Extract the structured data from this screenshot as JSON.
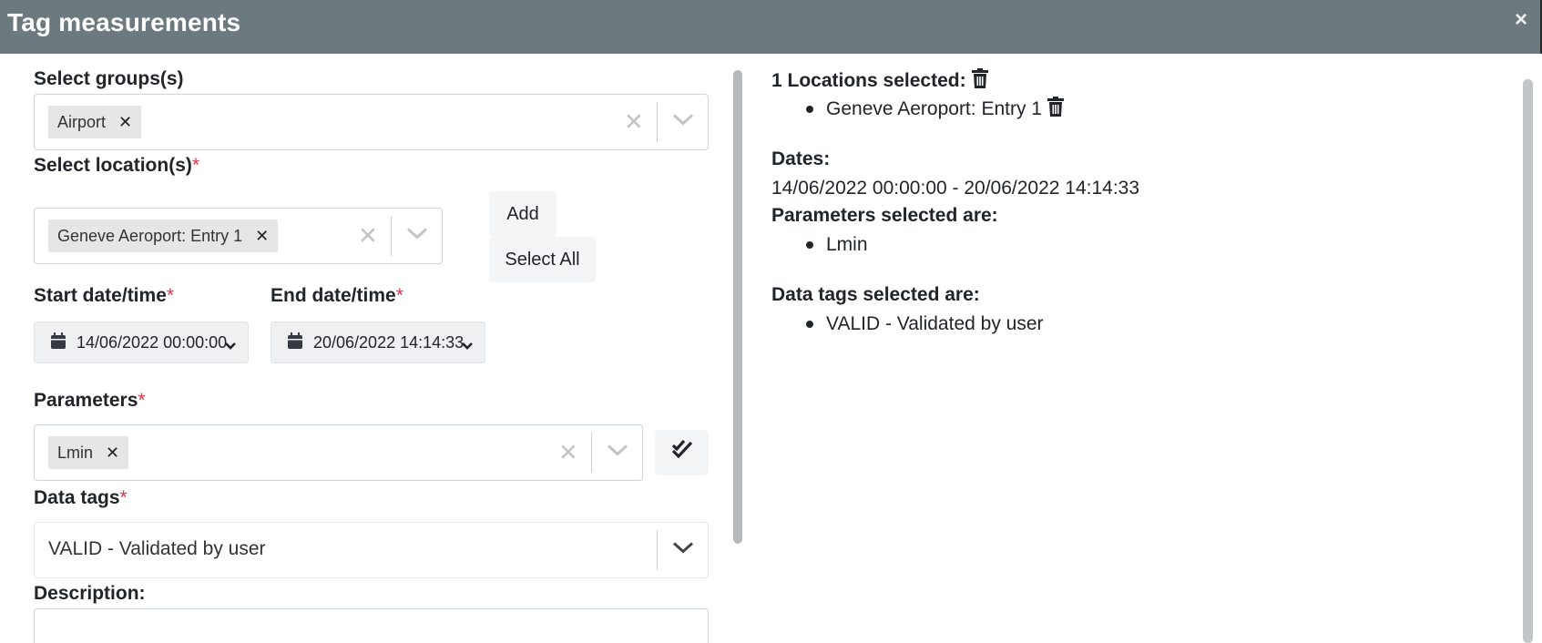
{
  "modal": {
    "title": "Tag measurements",
    "close_symbol": "×"
  },
  "form": {
    "groups": {
      "label": "Select groups(s)",
      "selected": [
        "Airport"
      ]
    },
    "locations": {
      "label": "Select location(s)",
      "required_mark": "*",
      "selected": [
        "Geneve Aeroport: Entry 1"
      ],
      "add_label": "Add",
      "select_all_label": "Select All"
    },
    "start": {
      "label": "Start date/time",
      "required_mark": "*",
      "value": "14/06/2022 00:00:00"
    },
    "end": {
      "label": "End date/time",
      "required_mark": "*",
      "value": "20/06/2022 14:14:33"
    },
    "parameters": {
      "label": "Parameters",
      "required_mark": "*",
      "selected": [
        "Lmin"
      ]
    },
    "data_tags": {
      "label": "Data tags",
      "required_mark": "*",
      "value": "VALID - Validated by user"
    },
    "description": {
      "label": "Description:"
    }
  },
  "summary": {
    "locations_heading": "1 Locations selected:",
    "locations": [
      "Geneve Aeroport: Entry 1"
    ],
    "dates_heading": "Dates:",
    "dates_value": "14/06/2022 00:00:00 - 20/06/2022 14:14:33",
    "parameters_heading": "Parameters selected are:",
    "parameters": [
      "Lmin"
    ],
    "tags_heading": "Data tags selected are:",
    "tags": [
      "VALID - Validated by user"
    ]
  },
  "icons": {
    "trash": "trash-icon",
    "calendar": "calendar-icon",
    "chevron": "chevron-down-icon",
    "clear": "clear-icon",
    "check_all": "double-check-icon"
  },
  "colors": {
    "header_bg": "#6c7a80",
    "required": "#dc3545"
  }
}
